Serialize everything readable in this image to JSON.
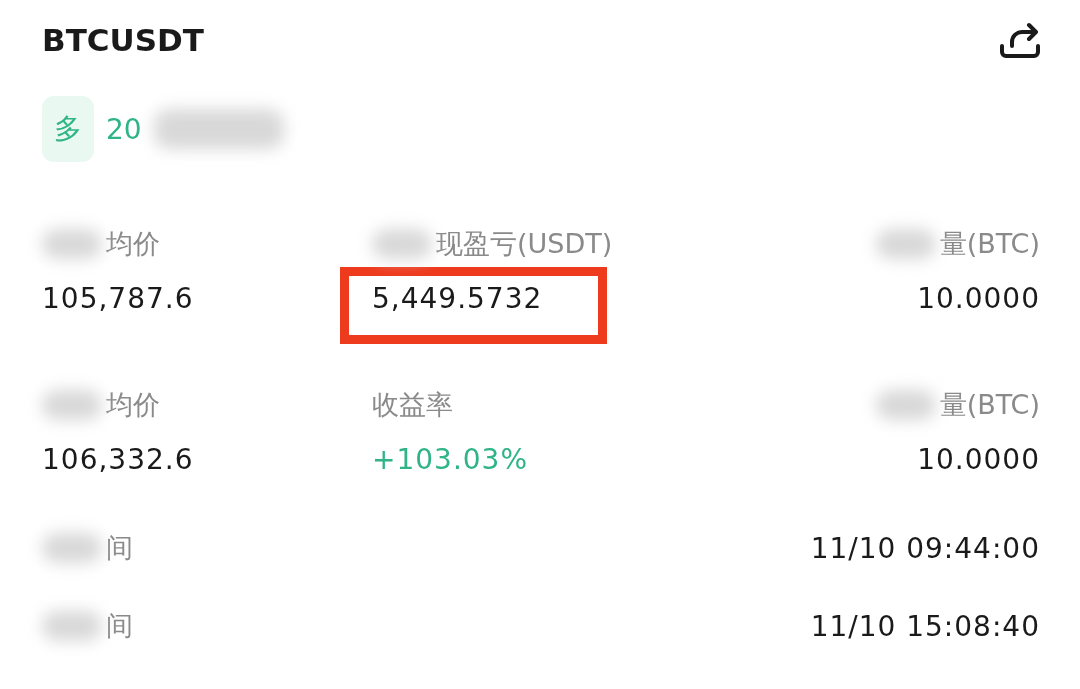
{
  "header": {
    "title": "BTCUSDT"
  },
  "position": {
    "side_tag": "多",
    "text": "20"
  },
  "stats": [
    {
      "label": "均价",
      "hidden_prefix": true,
      "value": "105,787.6",
      "highlighted": false,
      "kind": "plain"
    },
    {
      "label": "现盈亏(USDT)",
      "hidden_prefix": true,
      "value": "5,449.5732",
      "highlighted": true,
      "kind": "plain"
    },
    {
      "label": "量(BTC)",
      "hidden_prefix": true,
      "value": "10.0000",
      "highlighted": false,
      "kind": "plain"
    },
    {
      "label": "均价",
      "hidden_prefix": true,
      "value": "106,332.6",
      "highlighted": false,
      "kind": "plain"
    },
    {
      "label": "收益率",
      "hidden_prefix": false,
      "value": "+103.03%",
      "highlighted": false,
      "kind": "profit"
    },
    {
      "label": "量(BTC)",
      "hidden_prefix": true,
      "value": "10.0000",
      "highlighted": false,
      "kind": "plain"
    }
  ],
  "times": [
    {
      "label": "间",
      "value": "11/10 09:44:00"
    },
    {
      "label": "间",
      "value": "11/10 15:08:40"
    }
  ]
}
